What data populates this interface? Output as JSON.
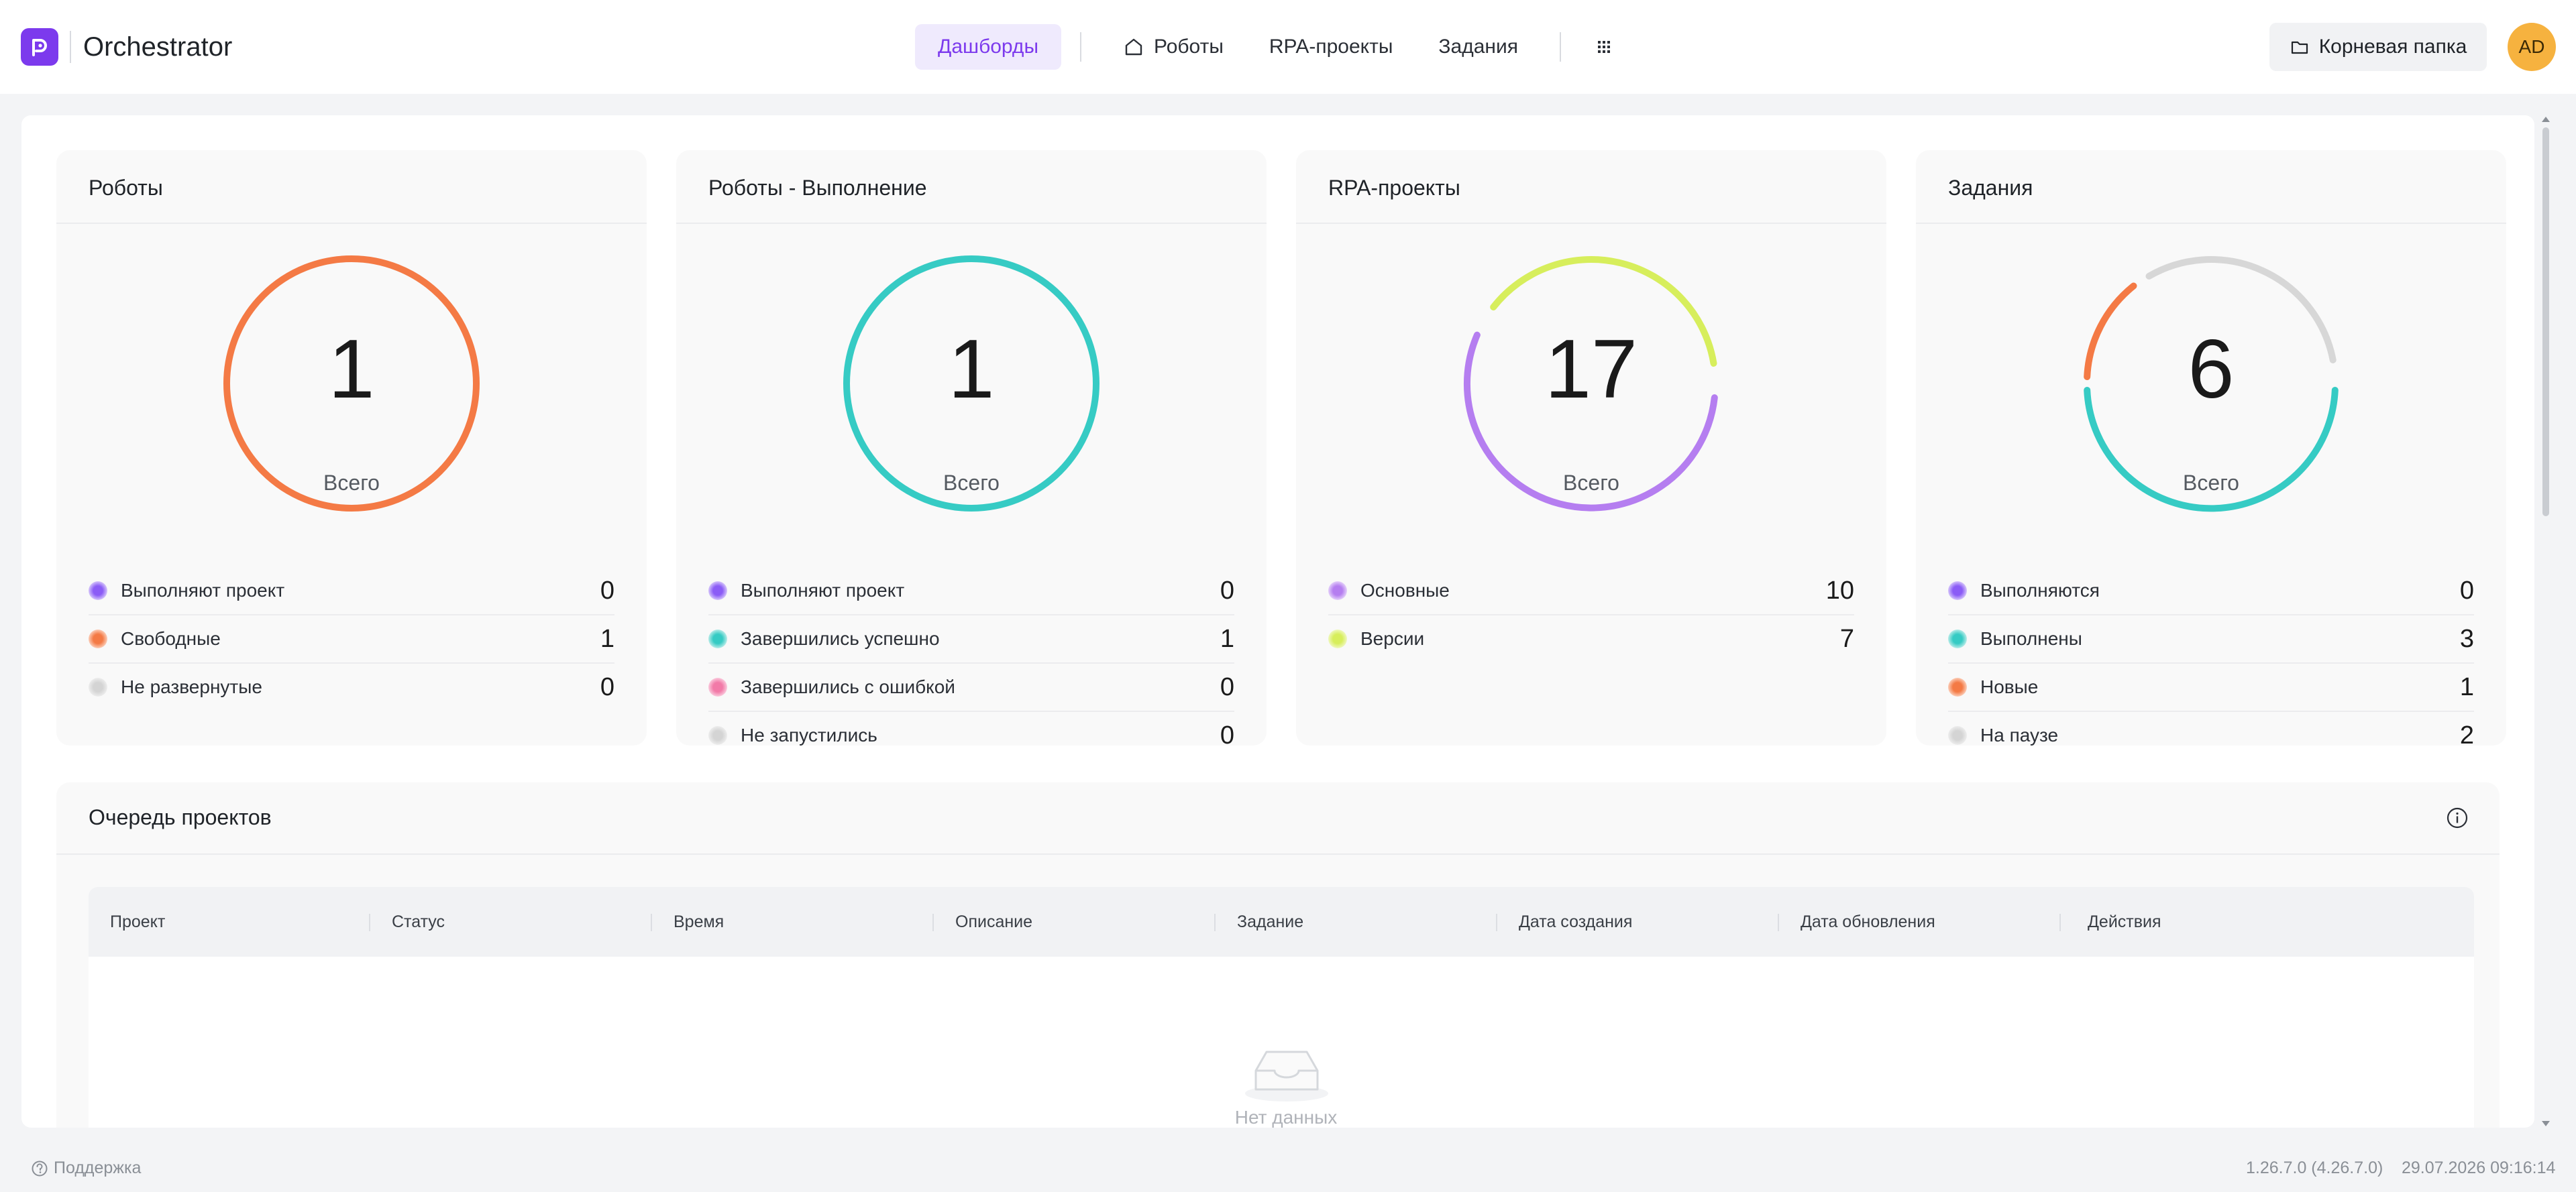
{
  "app": {
    "title": "Orchestrator"
  },
  "nav": {
    "dashboards": "Дашборды",
    "robots": "Роботы",
    "projects": "RPA-проекты",
    "tasks": "Задания"
  },
  "header": {
    "folder_label": "Корневая папка",
    "avatar_initials": "AD"
  },
  "cards": [
    {
      "title": "Роботы",
      "total": "1",
      "total_label": "Всего",
      "legend": [
        {
          "label": "Выполняют проект",
          "value": "0",
          "color": "#8b5cf6"
        },
        {
          "label": "Свободные",
          "value": "1",
          "color": "#f47a45"
        },
        {
          "label": "Не развернутые",
          "value": "0",
          "color": "#d9d9d9"
        }
      ]
    },
    {
      "title": "Роботы - Выполнение",
      "total": "1",
      "total_label": "Всего",
      "legend": [
        {
          "label": "Выполняют проект",
          "value": "0",
          "color": "#8b5cf6"
        },
        {
          "label": "Завершились успешно",
          "value": "1",
          "color": "#36cbc4"
        },
        {
          "label": "Завершились с ошибкой",
          "value": "0",
          "color": "#f27aa8"
        },
        {
          "label": "Не запустились",
          "value": "0",
          "color": "#d9d9d9"
        }
      ]
    },
    {
      "title": "RPA-проекты",
      "total": "17",
      "total_label": "Всего",
      "legend": [
        {
          "label": "Основные",
          "value": "10",
          "color": "#b57ef0"
        },
        {
          "label": "Версии",
          "value": "7",
          "color": "#d7ee5c"
        }
      ]
    },
    {
      "title": "Задания",
      "total": "6",
      "total_label": "Всего",
      "legend": [
        {
          "label": "Выполняются",
          "value": "0",
          "color": "#8b5cf6"
        },
        {
          "label": "Выполнены",
          "value": "3",
          "color": "#36cbc4"
        },
        {
          "label": "Новые",
          "value": "1",
          "color": "#f47a45"
        },
        {
          "label": "На паузе",
          "value": "2",
          "color": "#d9d9d9"
        }
      ]
    }
  ],
  "queue": {
    "title": "Очередь проектов",
    "columns": [
      "Проект",
      "Статус",
      "Время",
      "Описание",
      "Задание",
      "Дата создания",
      "Дата обновления",
      "Действия"
    ],
    "empty_text": "Нет данных"
  },
  "footer": {
    "support": "Поддержка",
    "version": "1.26.7.0 (4.26.7.0)",
    "datetime": "29.07.2026 09:16:14"
  }
}
